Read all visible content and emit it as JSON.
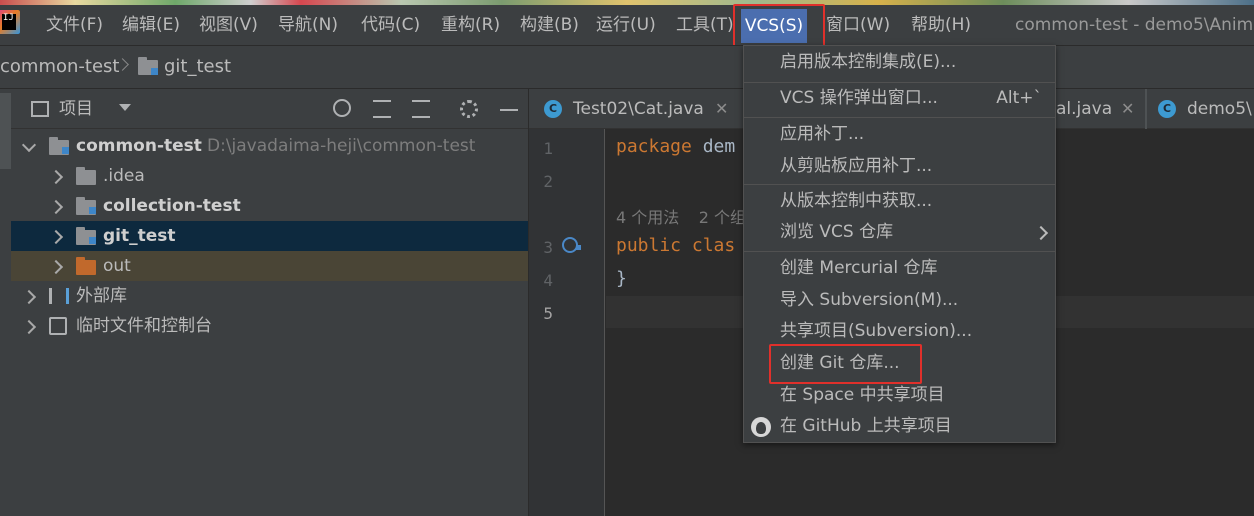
{
  "menubar": {
    "items": [
      "文件(F)",
      "编辑(E)",
      "视图(V)",
      "导航(N)",
      "代码(C)",
      "重构(R)",
      "构建(B)",
      "运行(U)",
      "工具(T)",
      "VCS(S)",
      "窗口(W)",
      "帮助(H)"
    ],
    "active": "VCS(S)",
    "window_title": "common-test - demo5\\Anim"
  },
  "breadcrumb": {
    "project": "common-test",
    "module": "git_test"
  },
  "project_panel": {
    "title": "项目",
    "tree": [
      {
        "label": "common-test",
        "path": "D:\\javadaima-heji\\common-test"
      },
      {
        "label": ".idea"
      },
      {
        "label": "collection-test"
      },
      {
        "label": "git_test"
      },
      {
        "label": "out"
      },
      {
        "label": "外部库"
      },
      {
        "label": "临时文件和控制台"
      }
    ]
  },
  "editor": {
    "tabs": [
      "Test02\\Cat.java",
      "al.java",
      "demo5\\"
    ],
    "line_numbers": [
      "1",
      "2",
      "3",
      "4",
      "5"
    ],
    "code": {
      "line1_kw": "package",
      "line1_rest": " dem",
      "hint_usages": "4 个用法",
      "hint_inheritors": "2 个组",
      "line3_kw": "public clas",
      "line4": "}"
    }
  },
  "vcs_menu": {
    "items": [
      {
        "label": "启用版本控制集成(E)..."
      },
      {
        "label": "VCS 操作弹出窗口...",
        "shortcut": "Alt+`"
      },
      {
        "label": "应用补丁..."
      },
      {
        "label": "从剪贴板应用补丁..."
      },
      {
        "label": "从版本控制中获取..."
      },
      {
        "label": "浏览 VCS 仓库"
      },
      {
        "label": "创建 Mercurial 仓库"
      },
      {
        "label": "导入 Subversion(M)..."
      },
      {
        "label": "共享项目(Subversion)..."
      },
      {
        "label": "创建 Git 仓库..."
      },
      {
        "label": "在 Space 中共享项目"
      },
      {
        "label": "在 GitHub 上共享项目"
      }
    ]
  },
  "colors": {
    "accent": "#4b6eaf",
    "highlight_border": "#e0302b",
    "selection": "#0d293e"
  }
}
